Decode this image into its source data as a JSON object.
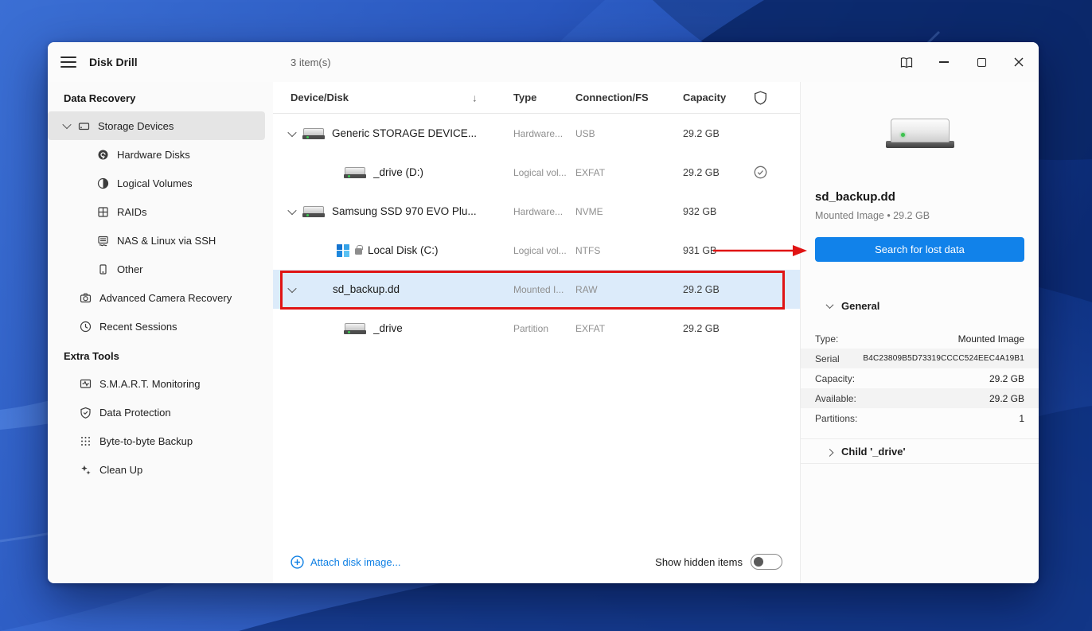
{
  "window": {
    "title": "Disk Drill",
    "items_count": "3 item(s)"
  },
  "sidebar": {
    "header_data_recovery": "Data Recovery",
    "header_extra_tools": "Extra Tools",
    "storage_devices": "Storage Devices",
    "hardware_disks": "Hardware Disks",
    "logical_volumes": "Logical Volumes",
    "raids": "RAIDs",
    "nas": "NAS & Linux via SSH",
    "other": "Other",
    "advanced_camera": "Advanced Camera Recovery",
    "recent_sessions": "Recent Sessions",
    "smart": "S.M.A.R.T. Monitoring",
    "data_protection": "Data Protection",
    "byte_backup": "Byte-to-byte Backup",
    "clean_up": "Clean Up"
  },
  "table": {
    "sort_indicator": "↓",
    "columns": {
      "device": "Device/Disk",
      "type": "Type",
      "connection": "Connection/FS",
      "capacity": "Capacity"
    },
    "selected_row_index": 4,
    "rows": [
      {
        "name": "Generic STORAGE DEVICE...",
        "type": "Hardware...",
        "fs": "USB",
        "capacity": "29.2 GB"
      },
      {
        "name": "_drive (D:)",
        "type": "Logical vol...",
        "fs": "EXFAT",
        "capacity": "29.2 GB"
      },
      {
        "name": "Samsung SSD 970 EVO Plu...",
        "type": "Hardware...",
        "fs": "NVME",
        "capacity": "932 GB"
      },
      {
        "name": "Local Disk (C:)",
        "type": "Logical vol...",
        "fs": "NTFS",
        "capacity": "931 GB"
      },
      {
        "name": "sd_backup.dd",
        "type": "Mounted I...",
        "fs": "RAW",
        "capacity": "29.2 GB"
      },
      {
        "name": "_drive",
        "type": "Partition",
        "fs": "EXFAT",
        "capacity": "29.2 GB"
      }
    ],
    "footer": {
      "attach": "Attach disk image...",
      "show_hidden": "Show hidden items",
      "show_hidden_enabled": false
    }
  },
  "details": {
    "title": "sd_backup.dd",
    "subtitle": "Mounted Image • 29.2 GB",
    "search_button": "Search for lost data",
    "general": "General",
    "props": [
      {
        "label": "Type:",
        "value": "Mounted Image"
      },
      {
        "label": "Serial",
        "value": "B4C23809B5D73319CCCC524EEC4A19B1"
      },
      {
        "label": "Capacity:",
        "value": "29.2 GB"
      },
      {
        "label": "Available:",
        "value": "29.2 GB"
      },
      {
        "label": "Partitions:",
        "value": "1"
      }
    ],
    "child": "Child '_drive'"
  },
  "annotations": {
    "color": "#e01414",
    "highlighted_row": "sd_backup.dd",
    "arrow_points_to": "Search for lost data"
  },
  "colors": {
    "accent_blue": "#1182ea",
    "selection_blue": "#dcebfa",
    "wallpaper_blue": "#2a58c0"
  }
}
